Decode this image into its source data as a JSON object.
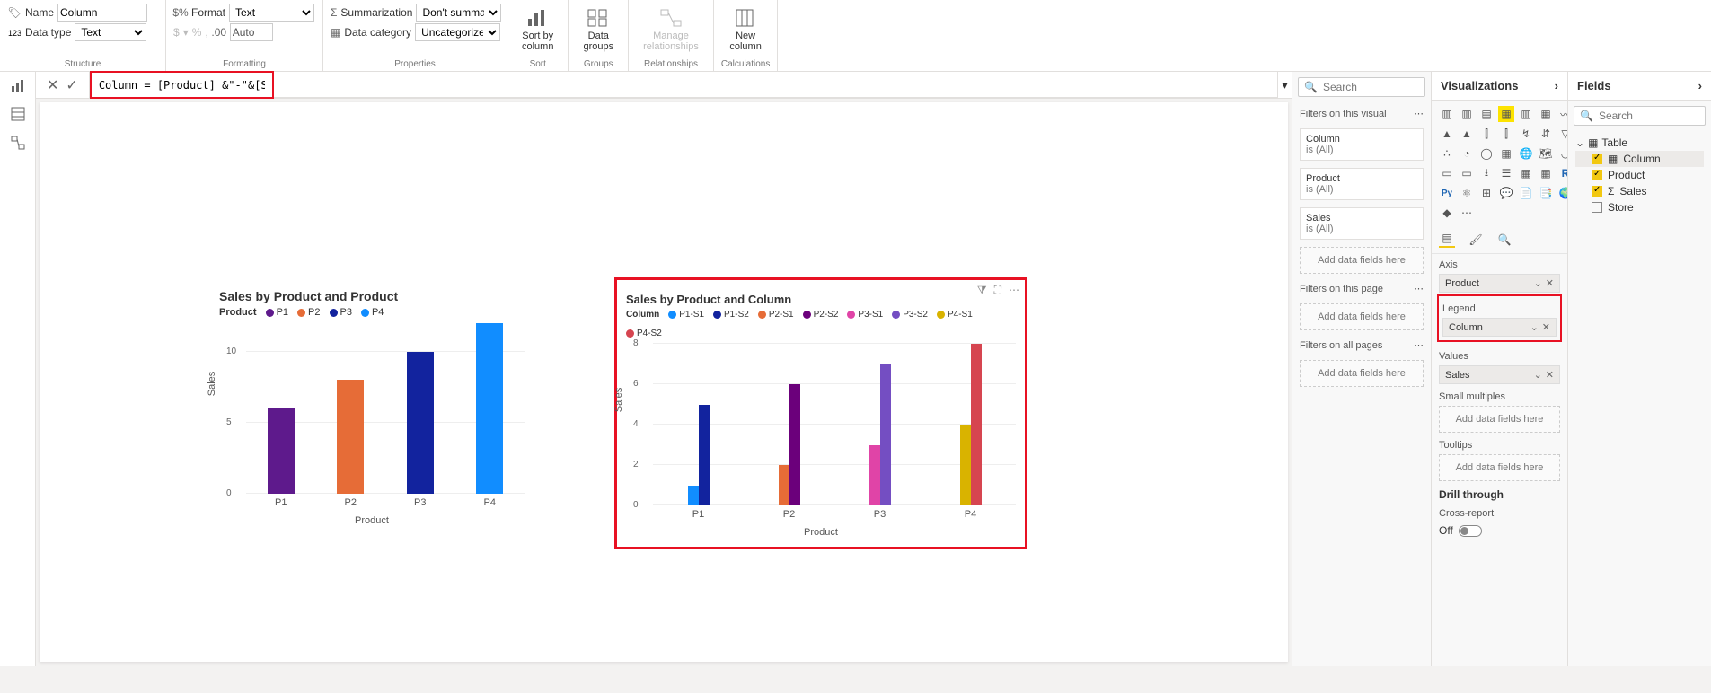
{
  "ribbon": {
    "name_label": "Name",
    "name_value": "Column",
    "datatype_label": "Data type",
    "datatype_value": "Text",
    "structure_group": "Structure",
    "format_label": "Format",
    "format_value": "Text",
    "currency_sym": "$",
    "percent_sym": "%",
    "comma_sym": ",",
    "decimals_value": "Auto",
    "formatting_group": "Formatting",
    "summarization_label": "Summarization",
    "summarization_value": "Don't summarize",
    "datacategory_label": "Data category",
    "datacategory_value": "Uncategorized",
    "properties_group": "Properties",
    "sortby": "Sort by\ncolumn",
    "sort_group": "Sort",
    "datagroups": "Data\ngroups",
    "groups_group": "Groups",
    "managerel": "Manage\nrelationships",
    "rel_group": "Relationships",
    "newcol": "New\ncolumn",
    "calc_group": "Calculations"
  },
  "formula": "Column = [Product] &\"-\"&[Store]",
  "chart1": {
    "title": "Sales by Product and Product",
    "legend_title": "Product",
    "xaxis": "Product",
    "yaxis": "Sales"
  },
  "chart2": {
    "title": "Sales by Product and Column",
    "legend_title": "Column",
    "xaxis": "Product",
    "yaxis": "Sales"
  },
  "chart_data": [
    {
      "type": "bar",
      "title": "Sales by Product and Product",
      "xlabel": "Product",
      "ylabel": "Sales",
      "ylim": [
        0,
        12
      ],
      "categories": [
        "P1",
        "P2",
        "P3",
        "P4"
      ],
      "series": [
        {
          "name": "P1",
          "color": "#5e1a8c",
          "values": [
            6,
            null,
            null,
            null
          ]
        },
        {
          "name": "P2",
          "color": "#e66c37",
          "values": [
            null,
            8,
            null,
            null
          ]
        },
        {
          "name": "P3",
          "color": "#12239e",
          "values": [
            null,
            null,
            10,
            null
          ]
        },
        {
          "name": "P4",
          "color": "#118dff",
          "values": [
            null,
            null,
            null,
            12
          ]
        }
      ]
    },
    {
      "type": "bar",
      "title": "Sales by Product and Column",
      "xlabel": "Product",
      "ylabel": "Sales",
      "ylim": [
        0,
        8
      ],
      "categories": [
        "P1",
        "P2",
        "P3",
        "P4"
      ],
      "series": [
        {
          "name": "P1-S1",
          "color": "#118dff",
          "values": [
            1,
            null,
            null,
            null
          ]
        },
        {
          "name": "P1-S2",
          "color": "#12239e",
          "values": [
            5,
            null,
            null,
            null
          ]
        },
        {
          "name": "P2-S1",
          "color": "#e66c37",
          "values": [
            null,
            2,
            null,
            null
          ]
        },
        {
          "name": "P2-S2",
          "color": "#6b007b",
          "values": [
            null,
            6,
            null,
            null
          ]
        },
        {
          "name": "P3-S1",
          "color": "#e044a7",
          "values": [
            null,
            null,
            3,
            null
          ]
        },
        {
          "name": "P3-S2",
          "color": "#744ec2",
          "values": [
            null,
            null,
            7,
            null
          ]
        },
        {
          "name": "P4-S1",
          "color": "#d9b300",
          "values": [
            null,
            null,
            null,
            4
          ]
        },
        {
          "name": "P4-S2",
          "color": "#d64550",
          "values": [
            null,
            null,
            null,
            8
          ]
        }
      ]
    }
  ],
  "filters": {
    "search_placeholder": "Search",
    "on_visual": "Filters on this visual",
    "f1_name": "Column",
    "f1_val": "is (All)",
    "f2_name": "Product",
    "f2_val": "is (All)",
    "f3_name": "Sales",
    "f3_val": "is (All)",
    "add_here": "Add data fields here",
    "on_page": "Filters on this page",
    "on_all": "Filters on all pages"
  },
  "viz": {
    "title": "Visualizations",
    "axis": "Axis",
    "axis_field": "Product",
    "legend": "Legend",
    "legend_field": "Column",
    "values": "Values",
    "values_field": "Sales",
    "small_mult": "Small multiples",
    "tooltips": "Tooltips",
    "add_here": "Add data fields here",
    "drill": "Drill through",
    "cross": "Cross-report",
    "off": "Off"
  },
  "fields": {
    "title": "Fields",
    "search_placeholder": "Search",
    "table": "Table",
    "col": "Column",
    "product": "Product",
    "sales": "Sales",
    "store": "Store"
  }
}
